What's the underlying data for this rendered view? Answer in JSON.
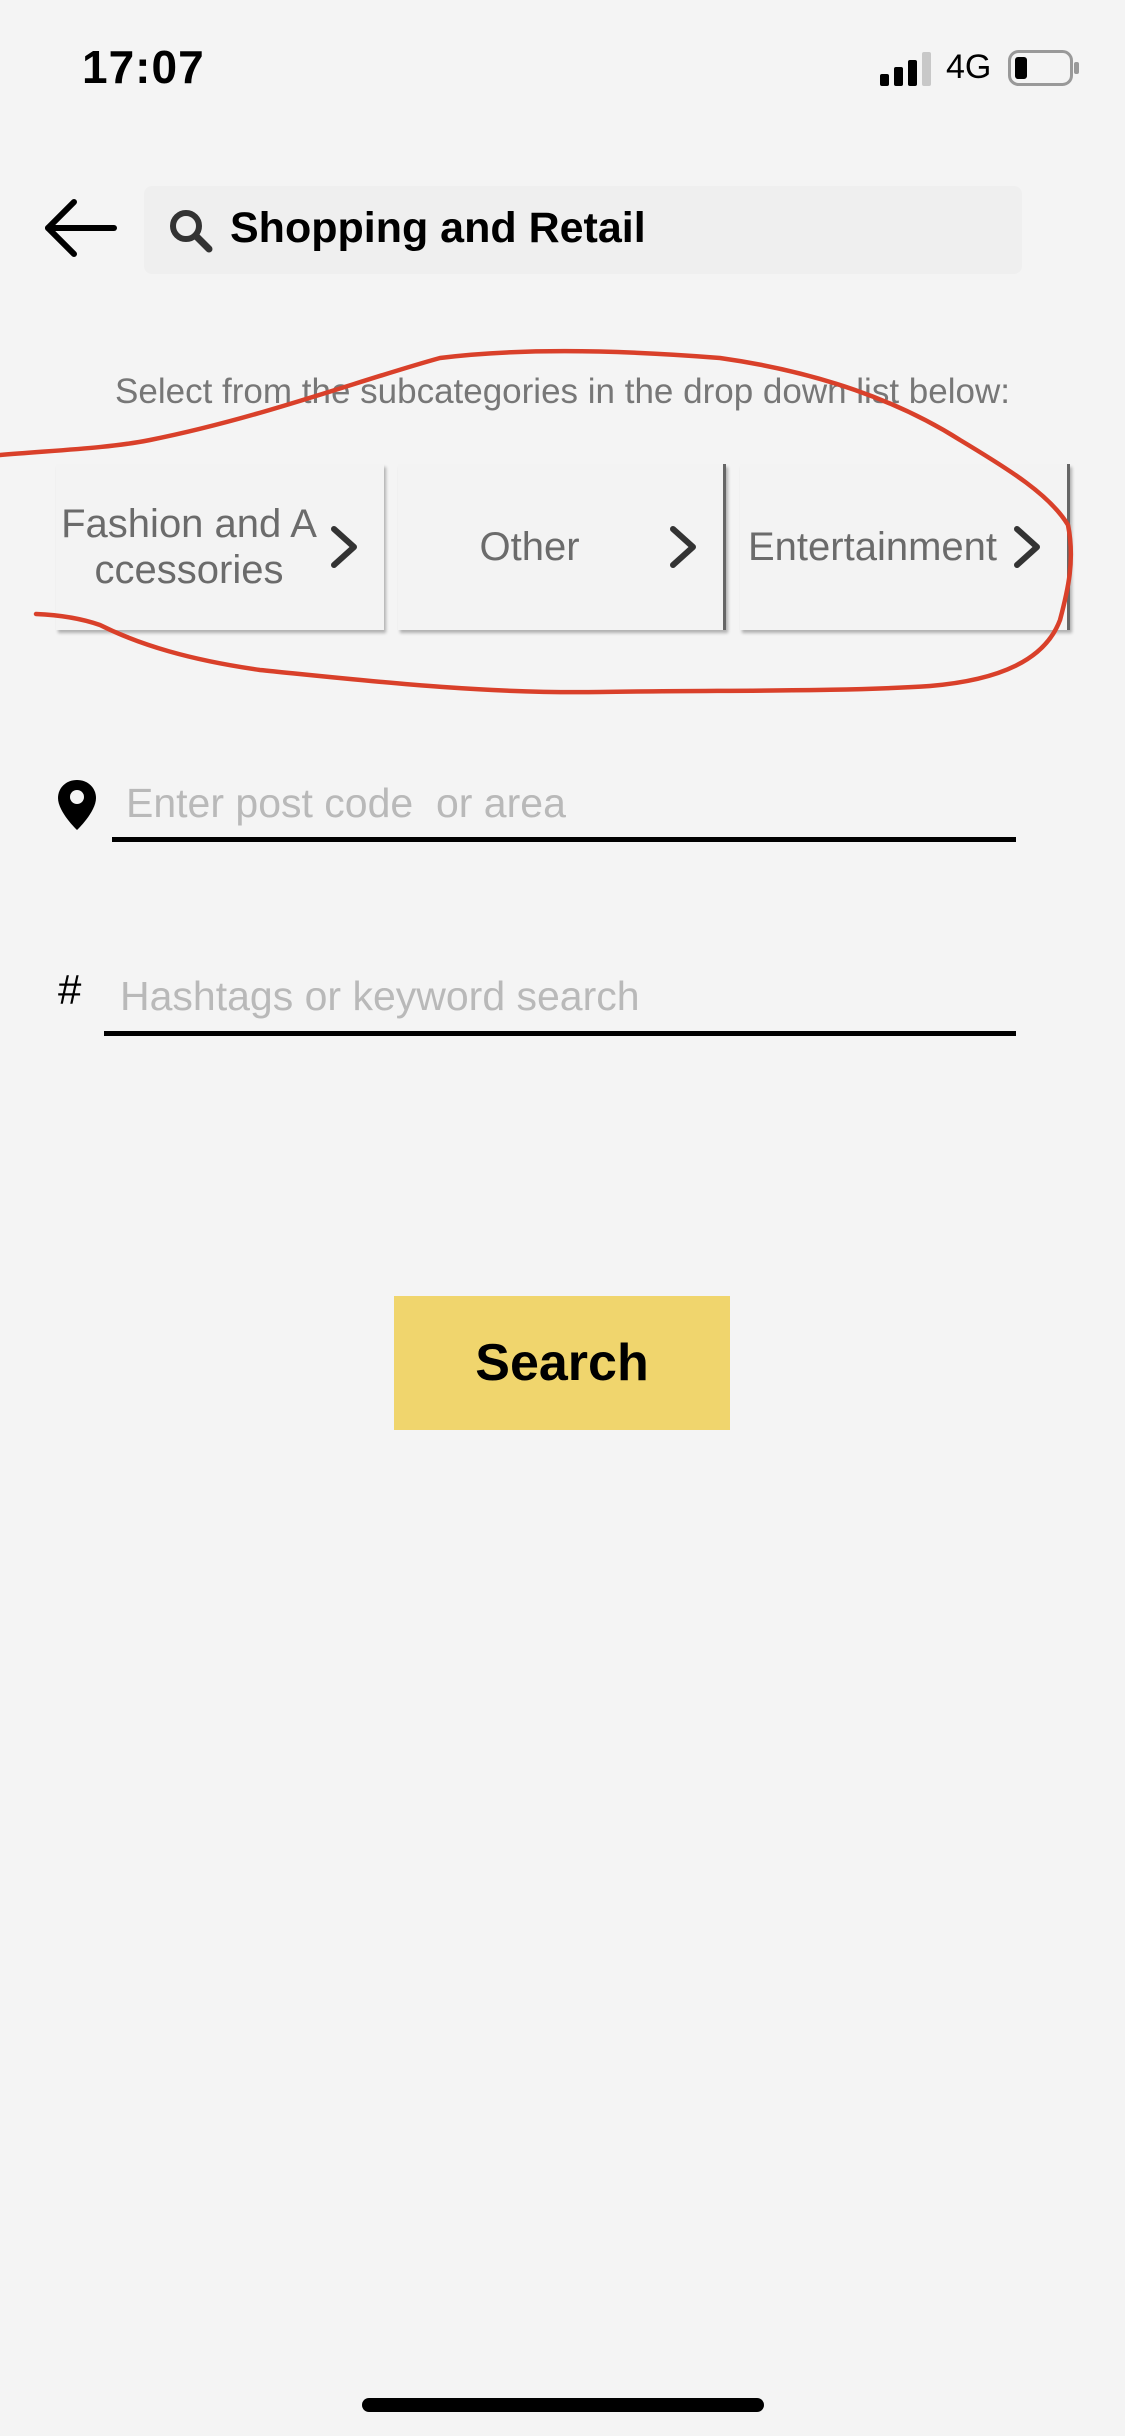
{
  "status_bar": {
    "time": "17:07",
    "network": "4G",
    "icons": [
      "signal-icon",
      "battery-icon"
    ]
  },
  "header": {
    "back_icon": "arrow-left-icon",
    "search_icon": "magnifier-icon",
    "title": "Shopping and Retail"
  },
  "subcategories": {
    "hint": "Select from the subcategories in the drop down list below:",
    "items": [
      {
        "label": "Fashion and Accessories"
      },
      {
        "label": "Other"
      },
      {
        "label": "Entertainment"
      }
    ],
    "chevron_icon": "chevron-right-icon"
  },
  "location": {
    "icon": "map-pin-icon",
    "placeholder": "Enter post code  or area",
    "value": ""
  },
  "keyword": {
    "symbol": "#",
    "placeholder": "Hashtags or keyword search",
    "value": ""
  },
  "search_button": {
    "label": "Search"
  },
  "colors": {
    "background": "#f4f4f4",
    "button": "#f0d56d",
    "annotation": "#d9402a",
    "placeholder": "#b9b9b9"
  }
}
